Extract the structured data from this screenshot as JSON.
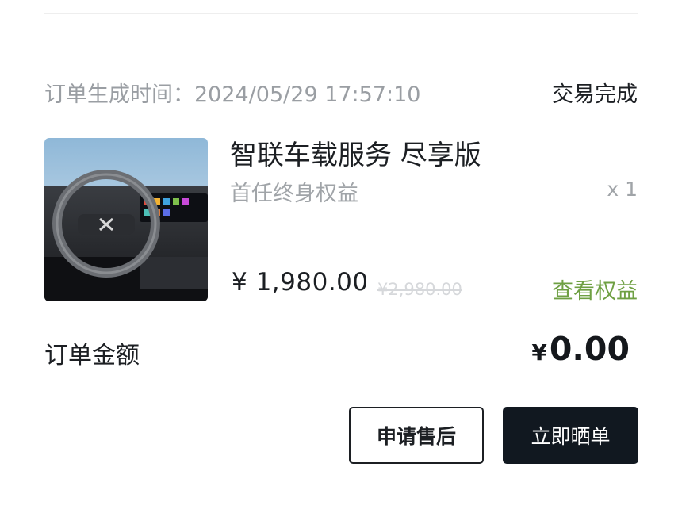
{
  "order": {
    "time_label": "订单生成时间：",
    "time_value": "2024/05/29 17:57:10",
    "status": "交易完成"
  },
  "product": {
    "image_icon": "car-steering-wheel-photo",
    "title": "智联车载服务 尽享版",
    "subtitle": "首任终身权益",
    "quantity": "x 1",
    "price": "¥ 1,980.00",
    "original_price": "¥2,980.00",
    "benefit_link": "查看权益"
  },
  "summary": {
    "amount_label": "订单金额",
    "currency_symbol": "¥",
    "amount_value": "0.00"
  },
  "actions": {
    "after_sale_label": "申请售后",
    "share_label": "立即晒单"
  },
  "colors": {
    "accent_green": "#6fa043",
    "primary_dark": "#111820"
  }
}
